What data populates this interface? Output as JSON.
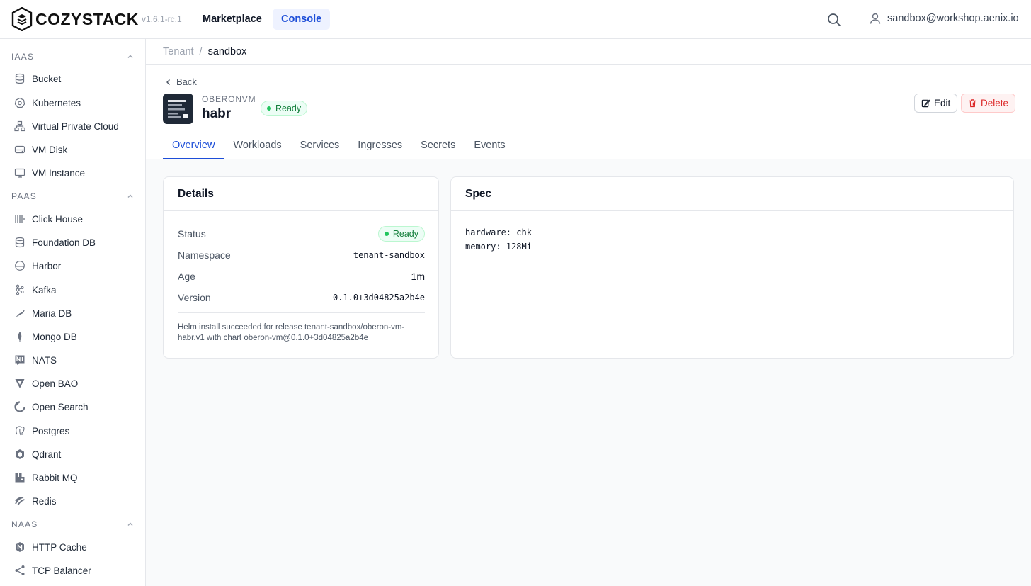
{
  "app": {
    "brand": "COZYSTACK",
    "version": "v1.6.1-rc.1",
    "nav": {
      "marketplace": "Marketplace",
      "console": "Console"
    },
    "user_email": "sandbox@workshop.aenix.io"
  },
  "sidebar": {
    "sections": [
      {
        "title": "IAAS",
        "items": [
          {
            "label": "Bucket",
            "icon": "database-icon"
          },
          {
            "label": "Kubernetes",
            "icon": "kubernetes-icon"
          },
          {
            "label": "Virtual Private Cloud",
            "icon": "network-icon"
          },
          {
            "label": "VM Disk",
            "icon": "hard-drive-icon"
          },
          {
            "label": "VM Instance",
            "icon": "monitor-icon"
          }
        ]
      },
      {
        "title": "PAAS",
        "items": [
          {
            "label": "Click House",
            "icon": "clickhouse-icon"
          },
          {
            "label": "Foundation DB",
            "icon": "database-icon"
          },
          {
            "label": "Harbor",
            "icon": "harbor-icon"
          },
          {
            "label": "Kafka",
            "icon": "kafka-icon"
          },
          {
            "label": "Maria DB",
            "icon": "mariadb-icon"
          },
          {
            "label": "Mongo DB",
            "icon": "mongodb-leaf-icon"
          },
          {
            "label": "NATS",
            "icon": "nats-icon"
          },
          {
            "label": "Open BAO",
            "icon": "openbao-icon"
          },
          {
            "label": "Open Search",
            "icon": "opensearch-icon"
          },
          {
            "label": "Postgres",
            "icon": "postgres-elephant-icon"
          },
          {
            "label": "Qdrant",
            "icon": "qdrant-icon"
          },
          {
            "label": "Rabbit MQ",
            "icon": "rabbitmq-icon"
          },
          {
            "label": "Redis",
            "icon": "redis-icon"
          }
        ]
      },
      {
        "title": "NAAS",
        "items": [
          {
            "label": "HTTP Cache",
            "icon": "http-cache-icon"
          },
          {
            "label": "TCP Balancer",
            "icon": "balancer-icon"
          }
        ]
      }
    ]
  },
  "breadcrumb": {
    "parent": "Tenant",
    "separator": "/",
    "current": "sandbox"
  },
  "header": {
    "back_label": "Back",
    "kind": "OBERONVM",
    "name": "habr",
    "status": "Ready",
    "edit_label": "Edit",
    "delete_label": "Delete"
  },
  "tabs": [
    "Overview",
    "Workloads",
    "Services",
    "Ingresses",
    "Secrets",
    "Events"
  ],
  "details": {
    "title": "Details",
    "rows": {
      "status_label": "Status",
      "status_value": "Ready",
      "namespace_label": "Namespace",
      "namespace_value": "tenant-sandbox",
      "age_label": "Age",
      "age_value": "1m",
      "version_label": "Version",
      "version_value": "0.1.0+3d04825a2b4e"
    },
    "message": "Helm install succeeded for release tenant-sandbox/oberon-vm-habr.v1 with chart oberon-vm@0.1.0+3d04825a2b4e"
  },
  "spec": {
    "title": "Spec",
    "lines": [
      "hardware: chk",
      "memory: 128Mi"
    ]
  },
  "colors": {
    "accent": "#1d4ed8",
    "ready_green": "#15803d",
    "danger": "#dc2626"
  }
}
